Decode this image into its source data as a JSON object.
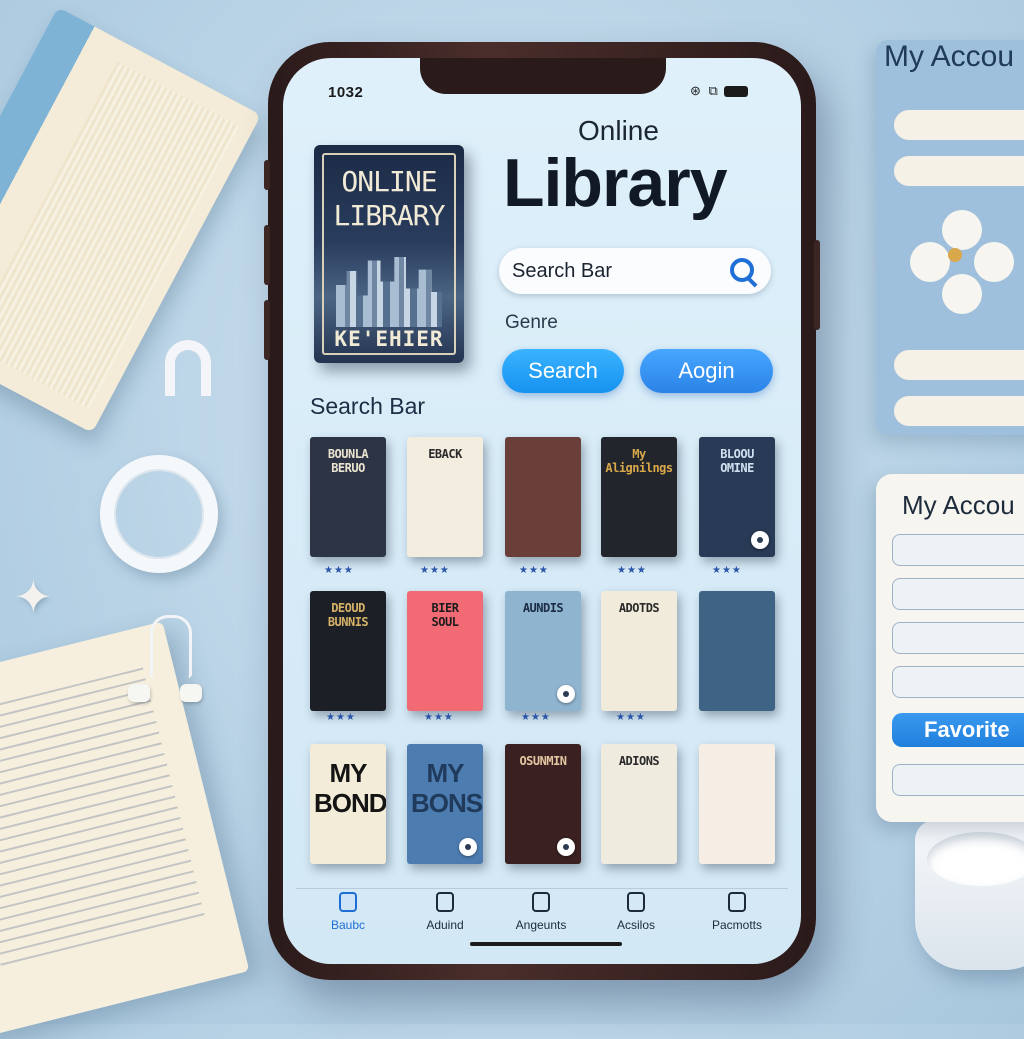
{
  "status_bar": {
    "time": "1032",
    "icons": "⊛ ⧉"
  },
  "hero_book": {
    "title": "ONLINE\nLIBRARY",
    "author": "KE'EHIER"
  },
  "header": {
    "subtitle": "Online",
    "title": "Library"
  },
  "search": {
    "placeholder": "Search Bar",
    "genre_label": "Genre"
  },
  "buttons": {
    "search": "Search",
    "login": "Aogin"
  },
  "section_label": "Search Bar",
  "colors": {
    "accent": "#1692f0",
    "screen_bg": "#dff0fa",
    "frame": "#2a1a1a"
  },
  "books": [
    {
      "title": "BOUNLA\nBERUO",
      "bg": "#2c3446",
      "fg": "#e9e3cf"
    },
    {
      "title": "EBACK",
      "bg": "#f3ede0",
      "fg": "#2a2a2a"
    },
    {
      "title": "",
      "bg": "#6a3f3a",
      "fg": "#f2e3c9"
    },
    {
      "title": "My\nAlignilngs",
      "bg": "#22252c",
      "fg": "#d9a84a"
    },
    {
      "title": "BLOOU\nOMINE",
      "bg": "#283a56",
      "fg": "#cfe0ef"
    },
    {
      "title": "DEOUD\nBUNNIS",
      "bg": "#1d1f26",
      "fg": "#d5b267"
    },
    {
      "title": "BIER\nSOUL",
      "bg": "#f26b74",
      "fg": "#1c1c1c"
    },
    {
      "title": "AUNDIS",
      "bg": "#8fb4d0",
      "fg": "#1c2c44"
    },
    {
      "title": "ADOTDS",
      "bg": "#f1ebdc",
      "fg": "#2a2a2a"
    },
    {
      "title": "",
      "bg": "#3e6384",
      "fg": "#f0f0f0"
    },
    {
      "title": "MY\nBONDS",
      "bg": "#f3ecd9",
      "fg": "#141414"
    },
    {
      "title": "MY\nBONS",
      "bg": "#4c7cb0",
      "fg": "#203a5c"
    },
    {
      "title": "OSUNMIN",
      "bg": "#3a2020",
      "fg": "#e3c7a3"
    },
    {
      "title": "ADIONS",
      "bg": "#f0ebdf",
      "fg": "#2a2a2a"
    },
    {
      "title": "",
      "bg": "#f6eee4",
      "fg": "#e2484a"
    }
  ],
  "ratings": [
    {
      "stars": "★★★"
    },
    {
      "stars": "★★★"
    },
    {
      "stars": "★★★"
    },
    {
      "stars": "★★★"
    },
    {
      "stars": "★★★"
    },
    {
      "stars": "★★★"
    },
    {
      "stars": "★★★"
    },
    {
      "stars": "★★★"
    },
    {
      "stars": "★★★"
    }
  ],
  "tabs": [
    {
      "label": "Baubc",
      "active": true
    },
    {
      "label": "Aduind",
      "active": false
    },
    {
      "label": "Angeunts",
      "active": false
    },
    {
      "label": "Acsilos",
      "active": false
    },
    {
      "label": "Pacmotts",
      "active": false
    }
  ],
  "side_panel_back": {
    "title": "My Accou"
  },
  "side_panel_front": {
    "title": "My Accou",
    "favorite_label": "Favorite"
  }
}
